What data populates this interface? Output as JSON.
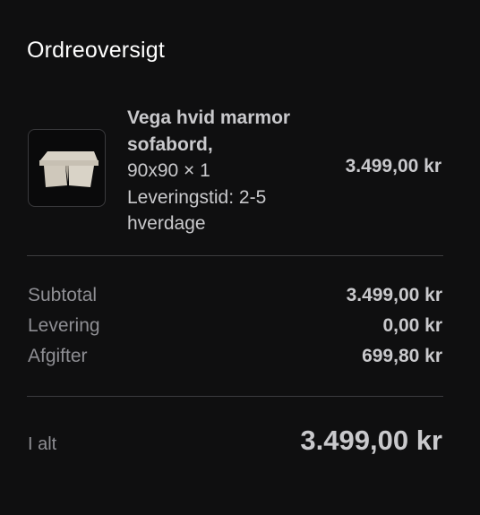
{
  "summary": {
    "title": "Ordreoversigt"
  },
  "item": {
    "name_line1": "Vega hvid marmor",
    "name_line2": "sofabord,",
    "variant_qty": "90x90 × 1",
    "delivery_line1": "Leveringstid: 2-5",
    "delivery_line2": "hverdage",
    "price": "3.499,00 kr",
    "image_icon": "marble-table-icon"
  },
  "totals": {
    "subtotal_label": "Subtotal",
    "subtotal_value": "3.499,00 kr",
    "shipping_label": "Levering",
    "shipping_value": "0,00 kr",
    "taxes_label": "Afgifter",
    "taxes_value": "699,80 kr",
    "total_label": "I alt",
    "total_value": "3.499,00 kr"
  }
}
